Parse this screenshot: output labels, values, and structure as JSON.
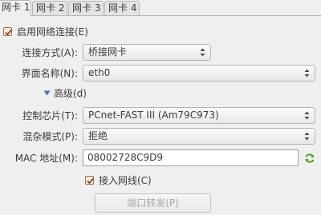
{
  "tabs": [
    {
      "label": "网卡 1"
    },
    {
      "label": "网卡 2"
    },
    {
      "label": "网卡 3"
    },
    {
      "label": "网卡 4"
    }
  ],
  "enable_adapter": {
    "label": "启用网络连接(E)",
    "checked": true
  },
  "attached_to": {
    "label": "连接方式(A):",
    "value": "桥接网卡"
  },
  "name": {
    "label": "界面名称(N):",
    "value": "eth0"
  },
  "advanced": {
    "label": "高级(d)",
    "expanded": true
  },
  "adapter_type": {
    "label": "控制芯片(T):",
    "value": "PCnet-FAST III (Am79C973)"
  },
  "promiscuous": {
    "label": "混杂模式(P):",
    "value": "拒绝"
  },
  "mac": {
    "label": "MAC 地址(M):",
    "value": "08002728C9D9"
  },
  "cable": {
    "label": "接入网线(C)",
    "checked": true
  },
  "port_forwarding": {
    "label": "端口转发(P)",
    "enabled": false
  },
  "colors": {
    "accent": "#dd4814",
    "refresh": "#4aa02c"
  }
}
